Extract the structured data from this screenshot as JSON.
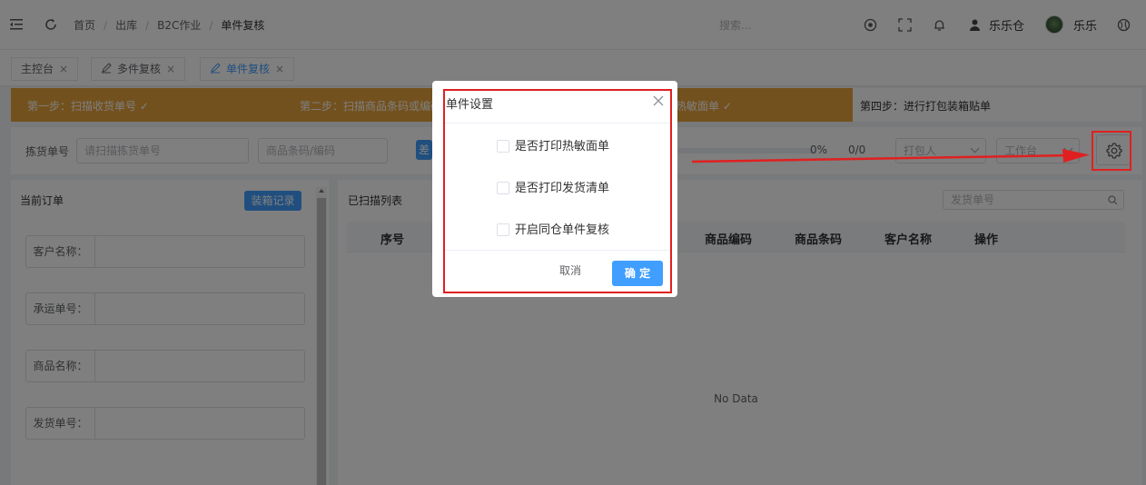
{
  "header": {
    "breadcrumb": [
      "首页",
      "出库",
      "B2C作业",
      "单件复核"
    ],
    "search_placeholder": "搜索...",
    "user1": "乐乐仓",
    "user2": "乐乐"
  },
  "tabs": [
    {
      "label": "主控台"
    },
    {
      "label": "多件复核"
    },
    {
      "label": "单件复核"
    }
  ],
  "steps": [
    {
      "label": "第一步：扫描收货单号 ✓"
    },
    {
      "label": "第二步：扫描商品条码或编码"
    },
    {
      "label": "印热敏面单 ✓"
    },
    {
      "label": "第四步：进行打包装箱贴单"
    }
  ],
  "search_row": {
    "picking_label": "拣货单号",
    "picking_placeholder": "请扫描拣货单号",
    "product_placeholder": "商品条码/编码",
    "btn_label": "差",
    "progress_pct": "0%",
    "progress_count": "0/0",
    "packer_placeholder": "打包人",
    "workstation_placeholder": "工作台",
    "progress_value": 0
  },
  "left_panel": {
    "title": "当前订单",
    "button": "装箱记录",
    "fields": [
      {
        "label": "客户名称："
      },
      {
        "label": "承运单号："
      },
      {
        "label": "商品名称："
      },
      {
        "label": "发货单号："
      }
    ]
  },
  "right_panel": {
    "title": "已扫描列表",
    "search_placeholder": "发货单号",
    "columns": [
      "序号",
      "商品编码",
      "商品条码",
      "客户名称",
      "操作"
    ],
    "empty_text": "No Data"
  },
  "dialog": {
    "title": "单件设置",
    "options": [
      {
        "label": "是否打印热敏面单",
        "checked": false
      },
      {
        "label": "是否打印发货清单",
        "checked": false
      },
      {
        "label": "开启同仓单件复核",
        "checked": false
      }
    ],
    "cancel": "取消",
    "confirm": "确 定"
  },
  "colors": {
    "accent": "#409eff",
    "step_done": "#e6a23c",
    "highlight": "#e02020"
  }
}
